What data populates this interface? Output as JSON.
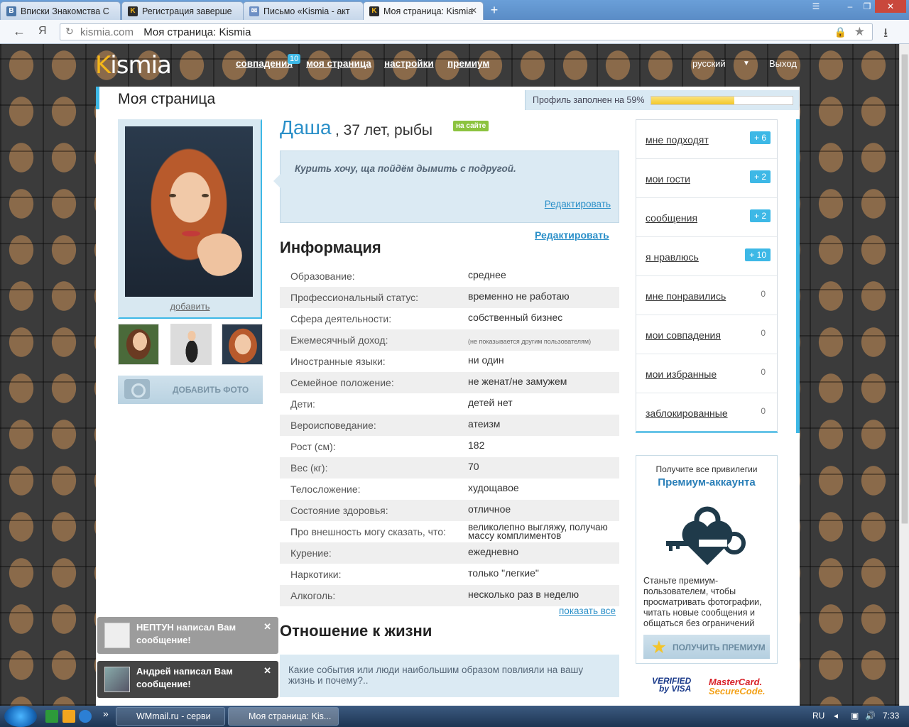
{
  "browser": {
    "tabs": [
      {
        "label": "Вписки Знакомства С",
        "fav": "В",
        "fav_color": "#4a76a8"
      },
      {
        "label": "Регистрация заверше",
        "fav": "K",
        "fav_color": "#2b2b2b"
      },
      {
        "label": "Письмо «Kismia - акт",
        "fav": "✉",
        "fav_color": "#6d8fc4"
      },
      {
        "label": "Моя страница: Kismia",
        "fav": "K",
        "fav_color": "#2b2b2b"
      }
    ],
    "domain": "kismia.com",
    "page_title": "Моя страница: Kismia",
    "yandex_glyph": "Я"
  },
  "site": {
    "logo": {
      "k": "K",
      "rest": "ismia"
    },
    "nav": [
      "совпадения",
      "моя страница",
      "настройки",
      "премиум"
    ],
    "matches_badge": "10",
    "language": "русский",
    "logout": "Выход"
  },
  "page": {
    "title": "Моя страница",
    "progress_label": "Профиль заполнен на 59%",
    "progress_value": 0.59
  },
  "photos": {
    "add_link": "добавить",
    "add_photo_button": "ДОБАВИТЬ ФОТО"
  },
  "profile": {
    "name": "Даша",
    "details": ", 37 лет, рыбы",
    "online": "на сайте",
    "status": "Курить хочу, ща пойдём дымить с подругой.",
    "status_edit": "Редактировать",
    "info_edit": "Редактировать",
    "info_heading": "Информация",
    "info": [
      {
        "k": "Образование:",
        "v": "среднее"
      },
      {
        "k": "Профессиональный статус:",
        "v": "временно не работаю"
      },
      {
        "k": "Сфера деятельности:",
        "v": "собственный бизнес"
      },
      {
        "k": "Ежемесячный доход:",
        "v": "(не показывается другим пользователям)"
      },
      {
        "k": "Иностранные языки:",
        "v": "ни один"
      },
      {
        "k": "Семейное положение:",
        "v": "не женат/не замужем"
      },
      {
        "k": "Дети:",
        "v": "детей нет"
      },
      {
        "k": "Вероисповедание:",
        "v": "атеизм"
      },
      {
        "k": "Рост (см):",
        "v": "182"
      },
      {
        "k": "Вес (кг):",
        "v": "70"
      },
      {
        "k": "Телосложение:",
        "v": "худощавое"
      },
      {
        "k": "Состояние здоровья:",
        "v": "отличное"
      },
      {
        "k": "Про внешность могу сказать, что:",
        "v": "великолепно выгляжу, получаю массу комплиментов"
      },
      {
        "k": "Курение:",
        "v": "ежедневно"
      },
      {
        "k": "Наркотики:",
        "v": "только \"легкие\""
      },
      {
        "k": "Алкоголь:",
        "v": "несколько раз в неделю"
      }
    ],
    "show_all": "показать все",
    "life_heading": "Отношение к жизни",
    "life_question": "Какие события или люди наибольшим образом повлияли на вашу жизнь и почему?.."
  },
  "sidebar": {
    "items": [
      {
        "label": "мне подходят",
        "count": "+ 6",
        "new": true
      },
      {
        "label": "мои гости",
        "count": "+ 2",
        "new": true
      },
      {
        "label": "сообщения",
        "count": "+ 2",
        "new": true
      },
      {
        "label": "я нравлюсь",
        "count": "+ 10",
        "new": true
      },
      {
        "label": "мне понравились",
        "count": "0",
        "new": false
      },
      {
        "label": "мои совпадения",
        "count": "0",
        "new": false
      },
      {
        "label": "мои избранные",
        "count": "0",
        "new": false
      },
      {
        "label": "заблокированные",
        "count": "0",
        "new": false
      }
    ]
  },
  "premium": {
    "line1": "Получите все привилегии",
    "line2": "Премиум-аккаунта",
    "description": "Станьте премиум-пользователем, чтобы просматривать фотографии, читать новые сообщения и общаться без ограничений",
    "button": "ПОЛУЧИТЬ ПРЕМИУМ",
    "verified_1": "VERIFIED",
    "verified_2": "by VISA",
    "mc_1": "MasterCard.",
    "mc_2": "SecureCode."
  },
  "notifications": [
    {
      "text": "НЕПТУН написал Вам сообщение!"
    },
    {
      "text": "Андрей написал Вам сообщение!"
    }
  ],
  "taskbar": {
    "tasks": [
      "WMmail.ru - серви",
      "Моя страница: Kis..."
    ],
    "lang": "RU",
    "time": "7:33",
    "chevron": "»"
  },
  "colors": {
    "accent": "#3db8e6",
    "link": "#2a8fc8",
    "online": "#8cc33f",
    "logo_k": "#f5b719"
  }
}
